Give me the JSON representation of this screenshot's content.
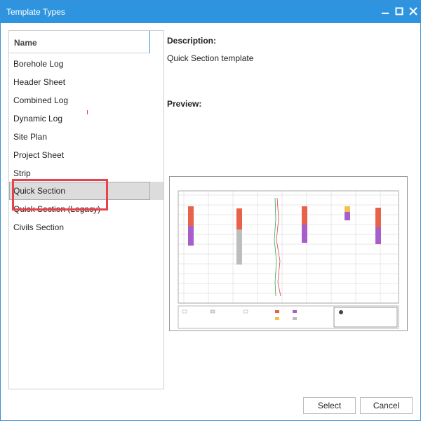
{
  "window": {
    "title": "Template Types"
  },
  "list": {
    "header": "Name",
    "items": [
      {
        "label": "Borehole Log"
      },
      {
        "label": "Header Sheet"
      },
      {
        "label": "Combined Log"
      },
      {
        "label": "Dynamic Log"
      },
      {
        "label": "Site Plan"
      },
      {
        "label": "Project Sheet"
      },
      {
        "label": "Strip"
      },
      {
        "label": "Quick Section",
        "selected": true
      },
      {
        "label": "Quick Section (Legacy)"
      },
      {
        "label": "Civils Section"
      }
    ]
  },
  "details": {
    "description_label": "Description:",
    "description_value": "Quick Section template",
    "preview_label": "Preview:"
  },
  "buttons": {
    "select": "Select",
    "cancel": "Cancel"
  },
  "colors": {
    "titlebar": "#2f94e0",
    "highlight": "#e8424a",
    "selected_bg": "#dcdcdc"
  }
}
